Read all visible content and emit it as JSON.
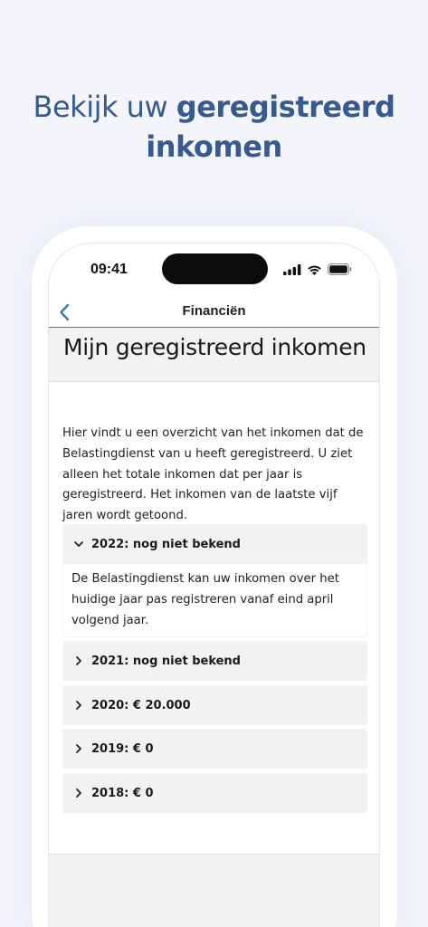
{
  "headline": {
    "part1": "Bekijk uw ",
    "part2": "geregistreerd",
    "part3": "inkomen"
  },
  "status_bar": {
    "time": "09:41",
    "icons": [
      "signal-icon",
      "wifi-icon",
      "battery-icon"
    ]
  },
  "nav": {
    "back_icon": "chevron-left-icon",
    "title": "Financiën"
  },
  "page": {
    "title": "Mijn geregistreerd inkomen",
    "intro": "Hier vindt u een overzicht van het inkomen dat de Belastingdienst van u heeft geregistreerd. U ziet alleen het totale inkomen dat per jaar is geregistreerd. Het inkomen van de laatste vijf jaren wordt getoond."
  },
  "accordion": [
    {
      "label": "2022: nog niet bekend",
      "expanded": true,
      "body": "De Belastingdienst kan uw inkomen over het huidige jaar pas registreren vanaf eind april volgend jaar."
    },
    {
      "label": "2021: nog niet bekend",
      "expanded": false
    },
    {
      "label": "2020: € 20.000",
      "expanded": false
    },
    {
      "label": "2019: € 0",
      "expanded": false
    },
    {
      "label": "2018: € 0",
      "expanded": false
    }
  ],
  "colors": {
    "headline": "#385a8f",
    "accent": "#3b78b8",
    "background": "#f3f5fb"
  }
}
